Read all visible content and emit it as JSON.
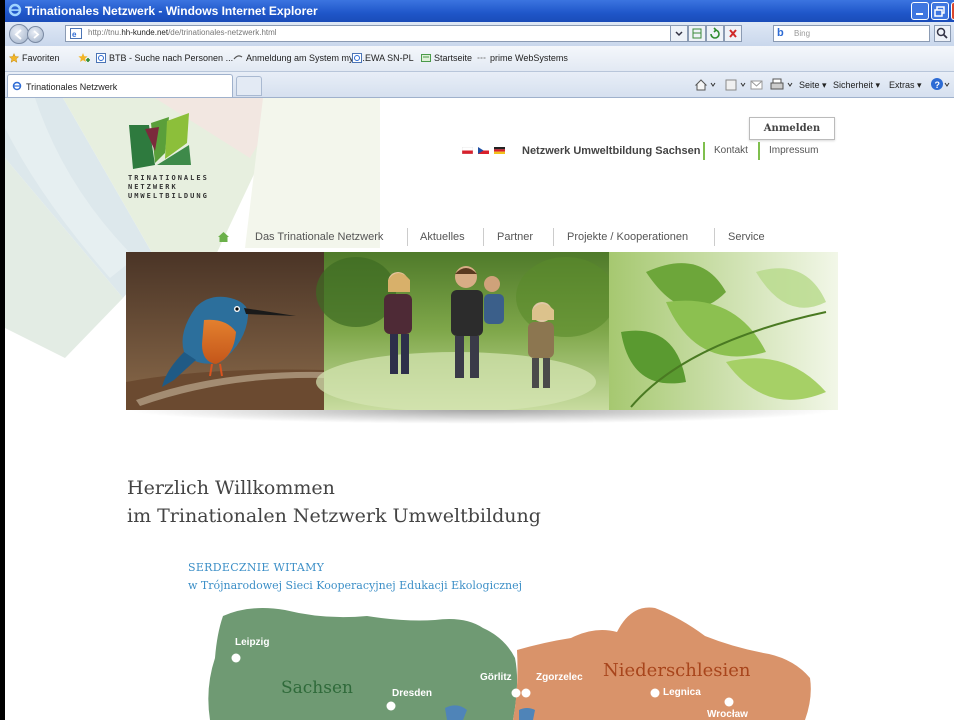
{
  "window": {
    "title": "Trinationales Netzwerk - Windows Internet Explorer"
  },
  "addressbar": {
    "url_prefix": "http://tnu.",
    "url_host": "hh-kunde.net",
    "url_path": "/de/trinationales-netzwerk.html",
    "search_placeholder": "Bing",
    "search_engine": "b"
  },
  "favorites": {
    "label": "Favoriten",
    "items": [
      {
        "label": "BTB - Suche nach Personen ...",
        "icon": "ie-page-icon"
      },
      {
        "label": "Anmeldung am System myty...",
        "icon": "link-icon"
      },
      {
        "label": "EWA SN-PL",
        "icon": "ie-page-icon"
      },
      {
        "label": "Startseite",
        "icon": "feed-icon"
      },
      {
        "label": "prime WebSystems",
        "icon": "link-icon"
      }
    ]
  },
  "tabs": {
    "active_label": "Trinationales Netzwerk"
  },
  "commandbar": {
    "seite": "Seite",
    "sicherheit": "Sicherheit",
    "extras": "Extras"
  },
  "site": {
    "logo_lines": [
      "TRINATIONALES",
      "NETZWERK",
      "UMWELTBILDUNG"
    ],
    "login_label": "Anmelden",
    "topnav": {
      "main": "Netzwerk Umweltbildung Sachsen",
      "kontakt": "Kontakt",
      "impressum": "Impressum"
    },
    "mainnav": [
      "Das Trinationale Netzwerk",
      "Aktuelles",
      "Partner",
      "Projekte / Kooperationen",
      "Service"
    ],
    "welcome_line1": "Herzlich Willkommen",
    "welcome_line2": "im Trinationalen Netzwerk Umweltbildung",
    "polish_line1": "SERDECZNIE WITAMY",
    "polish_line2": "w Trójnarodowej Sieci Kooperacyjnej Edukacji Ekologicznej",
    "map": {
      "regions": [
        "Sachsen",
        "Niederschlesien"
      ],
      "cities": [
        "Leipzig",
        "Dresden",
        "Görlitz",
        "Zgorzelec",
        "Legnica",
        "Wrocław"
      ]
    },
    "colors": {
      "green_accent": "#7fbf4d",
      "saxony_green": "#6f9a73",
      "silesia_orange": "#d9936a",
      "welcome_blue": "#3c8fc7"
    }
  }
}
